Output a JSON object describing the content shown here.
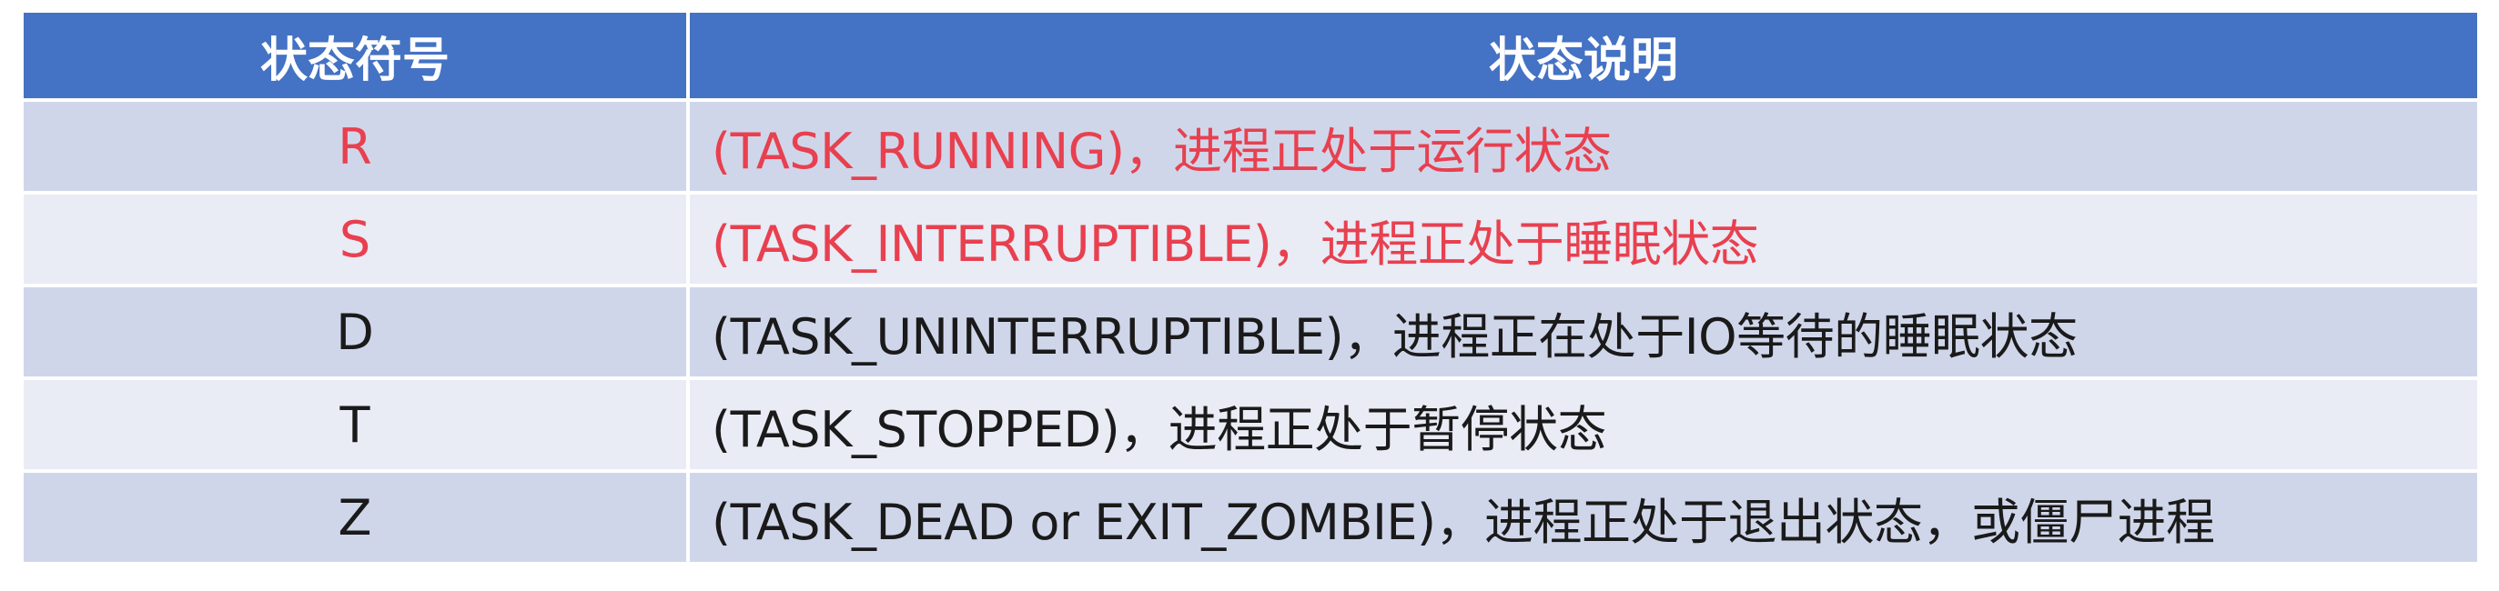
{
  "headers": {
    "symbol": "状态符号",
    "description": "状态说明"
  },
  "colors": {
    "header_bg": "#4472c4",
    "row_odd_bg": "#d0d6ea",
    "row_even_bg": "#e9ebf5",
    "highlight_text": "#e8404f",
    "normal_text": "#1a1a1a"
  },
  "rows": [
    {
      "symbol": "R",
      "description": "(TASK_RUNNING)，进程正处于运行状态",
      "highlighted": true
    },
    {
      "symbol": "S",
      "description": "(TASK_INTERRUPTIBLE)，进程正处于睡眠状态",
      "highlighted": true
    },
    {
      "symbol": "D",
      "description": "(TASK_UNINTERRUPTIBLE)，进程正在处于IO等待的睡眠状态",
      "highlighted": false
    },
    {
      "symbol": "T",
      "description": "(TASK_STOPPED)，进程正处于暂停状态",
      "highlighted": false
    },
    {
      "symbol": "Z",
      "description": "(TASK_DEAD or EXIT_ZOMBIE)，进程正处于退出状态，或僵尸进程",
      "highlighted": false
    }
  ]
}
